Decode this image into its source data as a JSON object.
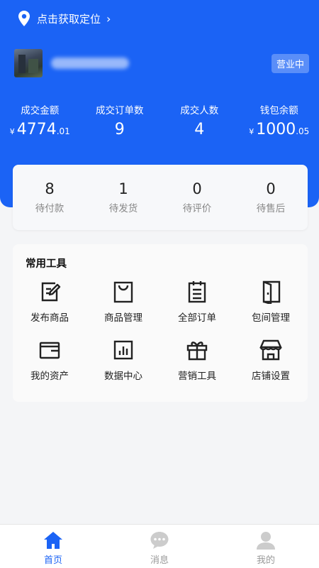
{
  "header": {
    "location_text": "点击获取定位",
    "status_badge": "营业中"
  },
  "stats": [
    {
      "label": "成交金额",
      "currency": "¥",
      "int": "4774",
      "dec": ".01"
    },
    {
      "label": "成交订单数",
      "currency": "",
      "int": "9",
      "dec": ""
    },
    {
      "label": "成交人数",
      "currency": "",
      "int": "4",
      "dec": ""
    },
    {
      "label": "钱包余额",
      "currency": "¥",
      "int": "1000",
      "dec": ".05"
    }
  ],
  "orders": [
    {
      "count": "8",
      "label": "待付款"
    },
    {
      "count": "1",
      "label": "待发货"
    },
    {
      "count": "0",
      "label": "待评价"
    },
    {
      "count": "0",
      "label": "待售后"
    }
  ],
  "tools": {
    "title": "常用工具",
    "items": [
      {
        "label": "发布商品",
        "icon": "edit-icon"
      },
      {
        "label": "商品管理",
        "icon": "bag-icon"
      },
      {
        "label": "全部订单",
        "icon": "clipboard-icon"
      },
      {
        "label": "包间管理",
        "icon": "door-icon"
      },
      {
        "label": "我的资产",
        "icon": "wallet-icon"
      },
      {
        "label": "数据中心",
        "icon": "bar-chart-icon"
      },
      {
        "label": "营销工具",
        "icon": "gift-icon"
      },
      {
        "label": "店铺设置",
        "icon": "store-icon"
      }
    ]
  },
  "tabbar": {
    "tabs": [
      {
        "label": "首页",
        "icon": "home-icon",
        "active": true
      },
      {
        "label": "消息",
        "icon": "message-icon",
        "active": false
      },
      {
        "label": "我的",
        "icon": "user-icon",
        "active": false
      }
    ]
  },
  "colors": {
    "primary": "#1b63f5",
    "tab_inactive": "#999999",
    "icon_inactive": "#cccccc"
  }
}
